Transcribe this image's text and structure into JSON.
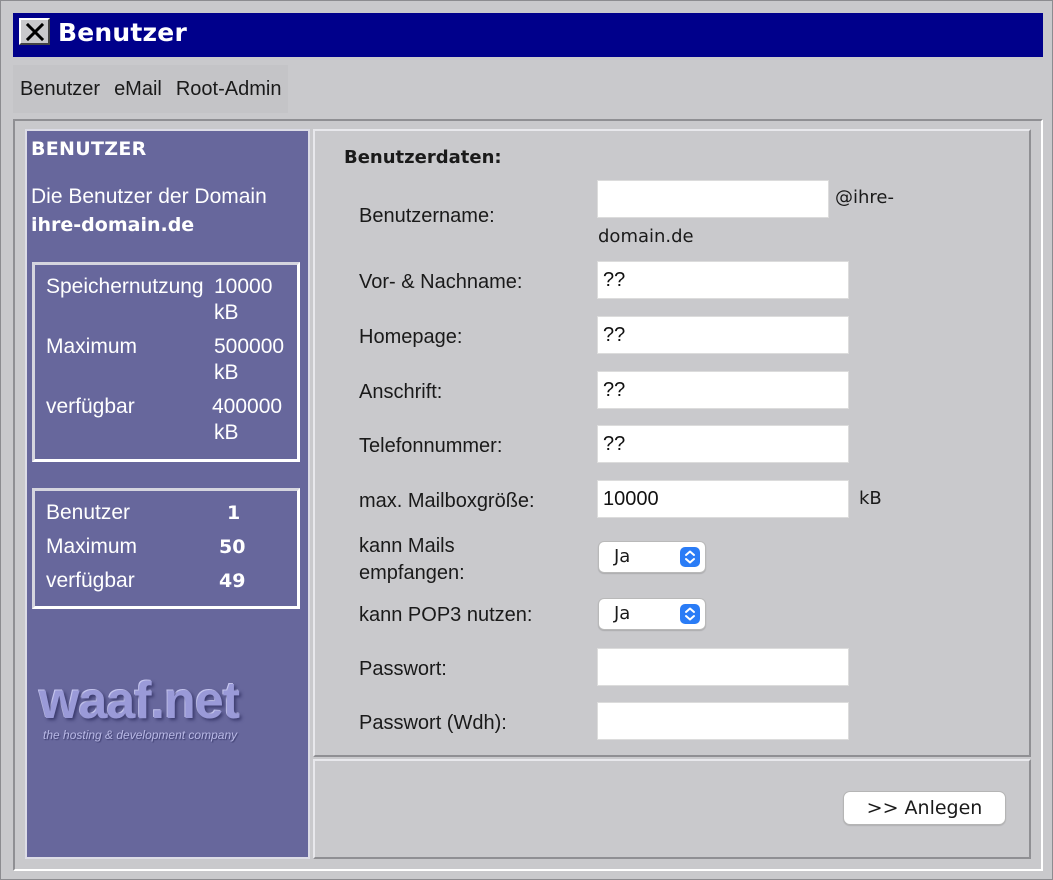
{
  "window": {
    "title": "Benutzer",
    "colors": {
      "titlebar": "#00008b",
      "sidebar": "#67679c",
      "background": "#c9c9cc"
    }
  },
  "menu": {
    "items": [
      {
        "label": "Benutzer"
      },
      {
        "label": "eMail"
      },
      {
        "label": "Root-Admin"
      }
    ]
  },
  "sidebar": {
    "heading": "BENUTZER",
    "intro": "Die Benutzer der Domain",
    "domain": "ihre-domain.de",
    "storage": {
      "rows": [
        {
          "label": "Speichernutzung",
          "value": "10000",
          "unit": "kB"
        },
        {
          "label": "Maximum",
          "value": "500000",
          "unit": "kB"
        },
        {
          "label": "verfügbar",
          "value": "400000",
          "unit": "kB"
        }
      ]
    },
    "users": {
      "rows": [
        {
          "label": "Benutzer",
          "value": "1"
        },
        {
          "label": "Maximum",
          "value": "50"
        },
        {
          "label": "verfügbar",
          "value": "49"
        }
      ]
    },
    "logo": {
      "name": "waaf.net",
      "tagline": "the hosting & development company"
    }
  },
  "form": {
    "heading": "Benutzerdaten:",
    "username": {
      "label": "Benutzername:",
      "value": "",
      "suffix_line1": "@ihre-",
      "suffix_line2": "domain.de"
    },
    "fullname": {
      "label": "Vor- & Nachname:",
      "value": "??"
    },
    "homepage": {
      "label": "Homepage:",
      "value": "??"
    },
    "address": {
      "label": "Anschrift:",
      "value": "??"
    },
    "phone": {
      "label": "Telefonnummer:",
      "value": "??"
    },
    "mailbox": {
      "label": "max. Mailboxgröße:",
      "value": "10000",
      "unit": "kB"
    },
    "receive": {
      "label_line1": "kann Mails",
      "label_line2": "empfangen:",
      "value": "Ja"
    },
    "pop3": {
      "label": "kann POP3 nutzen:",
      "value": "Ja"
    },
    "password": {
      "label": "Passwort:",
      "value": ""
    },
    "password_repeat": {
      "label": "Passwort (Wdh):",
      "value": ""
    },
    "submit_label": ">> Anlegen"
  }
}
